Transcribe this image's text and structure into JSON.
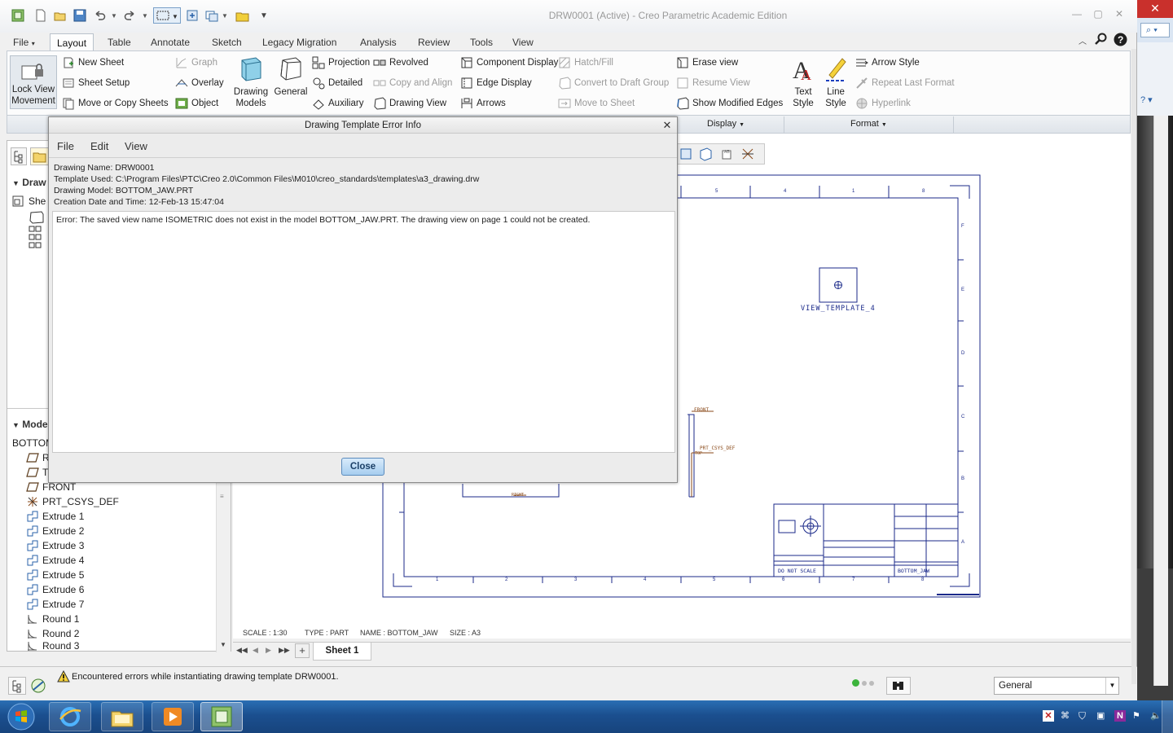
{
  "window": {
    "title": "DRW0001 (Active) - Creo Parametric Academic Edition"
  },
  "ribbon": {
    "tabs": [
      "File",
      "Layout",
      "Table",
      "Annotate",
      "Sketch",
      "Legacy Migration",
      "Analysis",
      "Review",
      "Tools",
      "View"
    ],
    "active_tab": "Layout",
    "lock_view": [
      "Lock View",
      "Movement"
    ],
    "sheets": [
      "New Sheet",
      "Sheet Setup",
      "Move or Copy Sheets"
    ],
    "insert": [
      "Graph",
      "Overlay",
      "Object"
    ],
    "drawing_models": [
      "Drawing",
      "Models"
    ],
    "general": "General",
    "views_a": [
      "Projection",
      "Detailed",
      "Auxiliary"
    ],
    "views_b": [
      "Revolved",
      "Copy and Align",
      "Drawing View"
    ],
    "display_a": [
      "Component Display",
      "Edge Display",
      "Arrows"
    ],
    "display_b": [
      "Hatch/Fill",
      "Convert to Draft Group",
      "Move to Sheet"
    ],
    "display_c": [
      "Erase view",
      "Resume View",
      "Show Modified Edges"
    ],
    "text_style": [
      "Text",
      "Style"
    ],
    "line_style": [
      "Line",
      "Style"
    ],
    "format": [
      "Arrow Style",
      "Repeat Last Format",
      "Hyperlink"
    ],
    "group_labels": {
      "display": "Display",
      "format": "Format"
    }
  },
  "left_panel": {
    "section_drawing": "Draw",
    "sheet_item": "She",
    "section_model": "Mode",
    "model_root": "BOTTOM",
    "tree": [
      "R",
      "T",
      "FRONT",
      "PRT_CSYS_DEF",
      "Extrude 1",
      "Extrude 2",
      "Extrude 3",
      "Extrude 4",
      "Extrude 5",
      "Extrude 6",
      "Extrude 7",
      "Round 1",
      "Round 2",
      "Round 3"
    ]
  },
  "drawing": {
    "view_label": "VIEW_TEMPLATE_4",
    "datum_front": "FRONT",
    "datum_csys": "PRT_CSYS_DEF",
    "datum_top": "TOP",
    "datum_right": "RIGHT",
    "do_not_scale": "DO NOT SCALE",
    "titleblock_name": "BOTTOM_JAW",
    "top_numbers": [
      "5",
      "4",
      "1",
      "8"
    ],
    "bottom_numbers": [
      "1",
      "2",
      "3",
      "4",
      "5",
      "6",
      "7",
      "8"
    ],
    "right_letters": [
      "F",
      "E",
      "D",
      "C",
      "B",
      "A"
    ]
  },
  "status_strip": {
    "scale": "SCALE : 1:30",
    "type": "TYPE : PART",
    "name": "NAME : BOTTOM_JAW",
    "size": "SIZE : A3"
  },
  "sheet_tab": "Sheet 1",
  "message": "Encountered errors while instantiating drawing template DRW0001.",
  "filter": "General",
  "dialog": {
    "title": "Drawing Template Error Info",
    "menu": [
      "File",
      "Edit",
      "View"
    ],
    "info": [
      "Drawing Name:  DRW0001",
      "Template Used:  C:\\Program Files\\PTC\\Creo 2.0\\Common Files\\M010\\creo_standards\\templates\\a3_drawing.drw",
      "Drawing Model:  BOTTOM_JAW.PRT",
      "Creation Date and Time:  12-Feb-13 15:47:04"
    ],
    "error": "Error:  The saved view name ISOMETRIC does not exist in the model BOTTOM_JAW.PRT.  The drawing view on page 1 could not be created.",
    "close": "Close"
  },
  "colors": {
    "ribbon_border": "#c5ccd4",
    "drawing_line": "#1b2a8a",
    "datum": "#8a4a1a",
    "taskbar": "#1b4f8f",
    "close_button": "#a6cdef"
  }
}
